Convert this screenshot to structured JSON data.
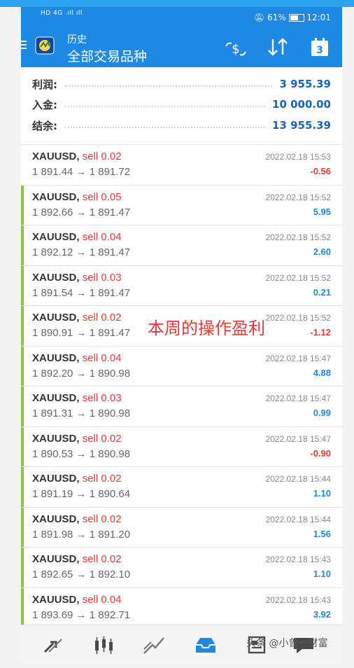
{
  "status": {
    "left_text": "HD 4G .ıll ıll",
    "battery": "61%",
    "time": "12:01"
  },
  "header": {
    "subtitle": "历史",
    "title": "全部交易品种"
  },
  "summary": [
    {
      "label": "利润:",
      "value": "3 955.39"
    },
    {
      "label": "入金:",
      "value": "10 000.00"
    },
    {
      "label": "结余:",
      "value": "13 955.39"
    }
  ],
  "trades": [
    {
      "symbol": "XAUUSD,",
      "side": "sell 0.02",
      "prices": "1 891.44 → 1 891.72",
      "time": "2022.02.18 15:53",
      "profit": "-0.56",
      "profit_color": "#e53935",
      "marked": false
    },
    {
      "symbol": "XAUUSD,",
      "side": "sell 0.05",
      "prices": "1 892.66 → 1 891.47",
      "time": "2022.02.18 15:52",
      "profit": "5.95",
      "profit_color": "#1e88e5",
      "marked": true
    },
    {
      "symbol": "XAUUSD,",
      "side": "sell 0.04",
      "prices": "1 892.12 → 1 891.47",
      "time": "2022.02.18 15:52",
      "profit": "2.60",
      "profit_color": "#1e88e5",
      "marked": true
    },
    {
      "symbol": "XAUUSD,",
      "side": "sell 0.03",
      "prices": "1 891.54 → 1 891.47",
      "time": "2022.02.18 15:52",
      "profit": "0.21",
      "profit_color": "#1e88e5",
      "marked": true
    },
    {
      "symbol": "XAUUSD,",
      "side": "sell 0.02",
      "prices": "1 890.91 → 1 891.47",
      "time": "2022.02.18 15:52",
      "profit": "-1.12",
      "profit_color": "#e53935",
      "marked": true
    },
    {
      "symbol": "XAUUSD,",
      "side": "sell 0.04",
      "prices": "1 892.20 → 1 890.98",
      "time": "2022.02.18 15:47",
      "profit": "4.88",
      "profit_color": "#1e88e5",
      "marked": true
    },
    {
      "symbol": "XAUUSD,",
      "side": "sell 0.03",
      "prices": "1 891.31 → 1 890.98",
      "time": "2022.02.18 15:47",
      "profit": "0.99",
      "profit_color": "#1e88e5",
      "marked": true
    },
    {
      "symbol": "XAUUSD,",
      "side": "sell 0.02",
      "prices": "1 890.53 → 1 890.98",
      "time": "2022.02.18 15:47",
      "profit": "-0.90",
      "profit_color": "#e53935",
      "marked": true
    },
    {
      "symbol": "XAUUSD,",
      "side": "sell 0.02",
      "prices": "1 891.19 → 1 890.64",
      "time": "2022.02.18 15:44",
      "profit": "1.10",
      "profit_color": "#1e88e5",
      "marked": true
    },
    {
      "symbol": "XAUUSD,",
      "side": "sell 0.02",
      "prices": "1 891.98 → 1 891.20",
      "time": "2022.02.18 15:44",
      "profit": "1.56",
      "profit_color": "#1e88e5",
      "marked": true
    },
    {
      "symbol": "XAUUSD,",
      "side": "sell 0.02",
      "prices": "1 892.65 → 1 892.10",
      "time": "2022.02.18 15:43",
      "profit": "1.10",
      "profit_color": "#1e88e5",
      "marked": true
    },
    {
      "symbol": "XAUUSD,",
      "side": "sell 0.04",
      "prices": "1 893.69 → 1 892.71",
      "time": "2022.02.18 15:43",
      "profit": "3.92",
      "profit_color": "#1e88e5",
      "marked": true
    }
  ],
  "overlay_text": "本周的操作盈利",
  "watermark": "头条 @小曾一财富",
  "nav_icons": [
    "trade-icon",
    "chart-icon",
    "analytics-icon",
    "history-icon",
    "news-icon"
  ],
  "colors": {
    "accent": "#1e88e5",
    "loss": "#e53935",
    "marker": "#8bc34a"
  }
}
